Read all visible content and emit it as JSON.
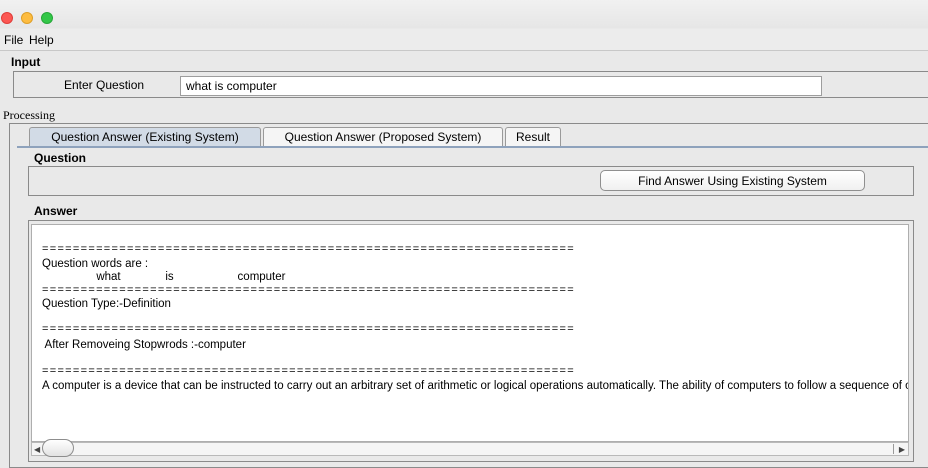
{
  "window": {
    "controls": [
      "close",
      "minimize",
      "maximize"
    ]
  },
  "menubar": {
    "items": [
      "File",
      "Help"
    ]
  },
  "input_panel": {
    "title": "Input",
    "label": "Enter Question",
    "value": "what is computer"
  },
  "processing": {
    "label": "Processing",
    "tabs": [
      {
        "label": "Question Answer (Existing System)",
        "active": true
      },
      {
        "label": "Question Answer (Proposed System)",
        "active": false
      },
      {
        "label": "Result",
        "active": false
      }
    ],
    "question_title": "Question",
    "find_button": "Find Answer Using Existing System",
    "answer_title": "Answer",
    "answer_lines": {
      "sep1": "=====================================================================",
      "words_label": "Question words are :",
      "words": "                 what              is                    computer",
      "sep2": "=====================================================================",
      "type": "Question Type:-Definition",
      "sep3": "=====================================================================",
      "stop": " After Removeing Stopwrods :-computer",
      "sep4": "=====================================================================",
      "answer": "A computer is a device that can be instructed to carry out an arbitrary set of arithmetic or logical operations automatically. The ability of computers to follow a sequence of operations, called a program, make computers very flexible and useful."
    }
  }
}
